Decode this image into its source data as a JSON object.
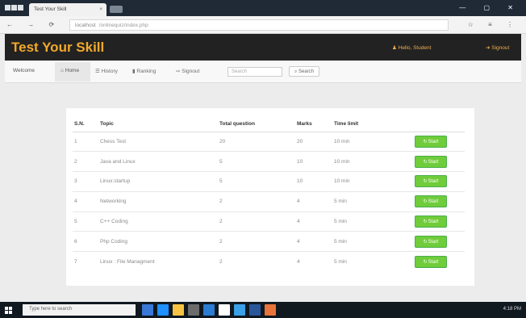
{
  "browser": {
    "tab_title": "Test Your Skill",
    "tab_close": "×",
    "url_secure": "localhost",
    "url_rest": "/onlinequiz/index.php",
    "nav_icons": "← → ⟳ ⌂",
    "right_icons": "☆ ≡ ⋮",
    "window_controls": "— ▢ ✕"
  },
  "app": {
    "brand": "Test Your Skill",
    "user_label": "Hello, Student",
    "logout_label": "Signout"
  },
  "menu": {
    "welcome": "Welcome",
    "home": "Home",
    "history": "History",
    "ranking": "Ranking",
    "signout": "Signout",
    "search_placeholder": "Search",
    "search_button": "Search"
  },
  "quiz_table": {
    "headers": [
      "S.N.",
      "Topic",
      "Total question",
      "Marks",
      "Time limit",
      ""
    ],
    "start_label": "Start",
    "rows": [
      {
        "sn": "1",
        "topic": "Chess Test",
        "total": "20",
        "marks": "20",
        "time": "10 min"
      },
      {
        "sn": "2",
        "topic": "Java and Linux",
        "total": "5",
        "marks": "10",
        "time": "10 min"
      },
      {
        "sn": "3",
        "topic": "Linux:startup",
        "total": "5",
        "marks": "10",
        "time": "10 min"
      },
      {
        "sn": "4",
        "topic": "Networking",
        "total": "2",
        "marks": "4",
        "time": "5 min"
      },
      {
        "sn": "5",
        "topic": "C++ Coding",
        "total": "2",
        "marks": "4",
        "time": "5 min"
      },
      {
        "sn": "6",
        "topic": "Php Coding",
        "total": "2",
        "marks": "4",
        "time": "5 min"
      },
      {
        "sn": "7",
        "topic": "Linux : File Managment",
        "total": "2",
        "marks": "4",
        "time": "5 min"
      }
    ]
  },
  "taskbar": {
    "search_text": "Type here to search",
    "tray_text": "4:18 PM",
    "icons": [
      "task-view-icon",
      "edge-icon",
      "file-explorer-icon",
      "store-icon",
      "mail-icon",
      "chrome-icon",
      "photos-icon",
      "word-icon",
      "app-icon"
    ],
    "icon_colors": [
      "#3a78d8",
      "#1e90ff",
      "#f6c342",
      "#6c6c6c",
      "#2b7cd3",
      "#ffffff",
      "#3aa1e8",
      "#2b579a",
      "#e8743b"
    ]
  }
}
